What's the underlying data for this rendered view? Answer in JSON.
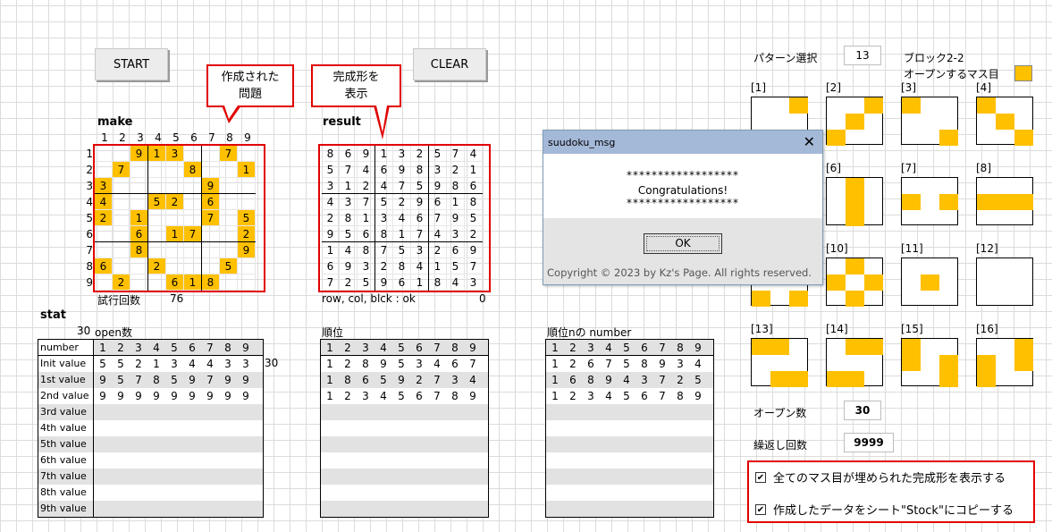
{
  "buttons": {
    "start": "START",
    "clear": "CLEAR"
  },
  "callouts": {
    "problem": [
      "作成された",
      "問題"
    ],
    "completed": [
      "完成形を",
      "表示"
    ]
  },
  "labels": {
    "make": "make",
    "result": "result",
    "trials_label": "試行回数",
    "trials_value": "76",
    "row_col_blck": "row, col, blck : ok",
    "ok_value": "0",
    "stat": "stat",
    "open_count_num": "30",
    "open_count_label": "open数",
    "rank": "順位",
    "rank_number": "順位nの number"
  },
  "colnums": [
    "1",
    "2",
    "3",
    "4",
    "5",
    "6",
    "7",
    "8",
    "9"
  ],
  "make_grid": [
    [
      "",
      "",
      "9",
      "1",
      "3",
      "",
      "",
      "7",
      ""
    ],
    [
      "",
      "7",
      "",
      "",
      "",
      "8",
      "",
      "",
      "1"
    ],
    [
      "3",
      "",
      "",
      "",
      "",
      "",
      "9",
      "",
      ""
    ],
    [
      "4",
      "",
      "",
      "5",
      "2",
      "",
      "6",
      "",
      ""
    ],
    [
      "2",
      "",
      "1",
      "",
      "",
      "",
      "7",
      "",
      "5"
    ],
    [
      "",
      "",
      "6",
      "",
      "1",
      "7",
      "",
      "",
      "2"
    ],
    [
      "",
      "",
      "8",
      "",
      "",
      "",
      "",
      "",
      "9"
    ],
    [
      "6",
      "",
      "",
      "2",
      "",
      "",
      "",
      "5",
      ""
    ],
    [
      "",
      "2",
      "",
      "",
      "6",
      "1",
      "8",
      "",
      ""
    ]
  ],
  "make_highlight": [
    [
      0,
      0,
      1,
      1,
      1,
      0,
      0,
      1,
      0
    ],
    [
      0,
      1,
      0,
      0,
      0,
      1,
      0,
      0,
      1
    ],
    [
      1,
      0,
      0,
      0,
      0,
      0,
      1,
      0,
      0
    ],
    [
      1,
      0,
      0,
      1,
      1,
      0,
      1,
      0,
      0
    ],
    [
      1,
      0,
      1,
      0,
      0,
      0,
      1,
      0,
      1
    ],
    [
      0,
      0,
      1,
      0,
      1,
      1,
      0,
      0,
      1
    ],
    [
      0,
      0,
      1,
      0,
      0,
      0,
      0,
      0,
      1
    ],
    [
      1,
      0,
      0,
      1,
      0,
      0,
      0,
      1,
      0
    ],
    [
      0,
      1,
      0,
      0,
      1,
      1,
      1,
      0,
      0
    ]
  ],
  "result_grid": [
    [
      "8",
      "6",
      "9",
      "1",
      "3",
      "2",
      "5",
      "7",
      "4"
    ],
    [
      "5",
      "7",
      "4",
      "6",
      "9",
      "8",
      "3",
      "2",
      "1"
    ],
    [
      "3",
      "1",
      "2",
      "4",
      "7",
      "5",
      "9",
      "8",
      "6"
    ],
    [
      "4",
      "3",
      "7",
      "5",
      "2",
      "9",
      "6",
      "1",
      "8"
    ],
    [
      "2",
      "8",
      "1",
      "3",
      "4",
      "6",
      "7",
      "9",
      "5"
    ],
    [
      "9",
      "5",
      "6",
      "8",
      "1",
      "7",
      "4",
      "3",
      "2"
    ],
    [
      "1",
      "4",
      "8",
      "7",
      "5",
      "3",
      "2",
      "6",
      "9"
    ],
    [
      "6",
      "9",
      "3",
      "2",
      "8",
      "4",
      "1",
      "5",
      "7"
    ],
    [
      "7",
      "2",
      "5",
      "9",
      "6",
      "1",
      "8",
      "4",
      "3"
    ]
  ],
  "stat_table": {
    "header": "number",
    "rows": [
      {
        "label": "Init value",
        "values": [
          "5",
          "5",
          "2",
          "1",
          "3",
          "4",
          "4",
          "3",
          "3"
        ],
        "extra": "30"
      },
      {
        "label": "1st value",
        "values": [
          "9",
          "5",
          "7",
          "8",
          "5",
          "9",
          "7",
          "9",
          "9"
        ]
      },
      {
        "label": "2nd value",
        "values": [
          "9",
          "9",
          "9",
          "9",
          "9",
          "9",
          "9",
          "9",
          "9"
        ]
      },
      {
        "label": "3rd value",
        "values": []
      },
      {
        "label": "4th value",
        "values": []
      },
      {
        "label": "5th value",
        "values": []
      },
      {
        "label": "6th value",
        "values": []
      },
      {
        "label": "7th value",
        "values": []
      },
      {
        "label": "8th value",
        "values": []
      },
      {
        "label": "9th value",
        "values": []
      }
    ]
  },
  "rank_table": [
    [
      "1",
      "2",
      "8",
      "9",
      "5",
      "3",
      "4",
      "6",
      "7"
    ],
    [
      "1",
      "8",
      "6",
      "5",
      "9",
      "2",
      "7",
      "3",
      "4"
    ],
    [
      "1",
      "2",
      "3",
      "4",
      "5",
      "6",
      "7",
      "8",
      "9"
    ]
  ],
  "rank_number_table": [
    [
      "1",
      "2",
      "6",
      "7",
      "5",
      "8",
      "9",
      "3",
      "4"
    ],
    [
      "1",
      "6",
      "8",
      "9",
      "4",
      "3",
      "7",
      "2",
      "5"
    ],
    [
      "1",
      "2",
      "3",
      "4",
      "5",
      "6",
      "7",
      "8",
      "9"
    ]
  ],
  "right": {
    "pattern_label": "パターン選択",
    "pattern_value": "13",
    "block_label": "ブロック2-2",
    "open_cell_label": "オープンするマス目",
    "open_count_label": "オープン数",
    "open_count_value": "30",
    "repeat_label": "繰返し回数",
    "repeat_value": "9999",
    "check1": "全てのマス目が埋められた完成形を表示する",
    "check2": "作成したデータをシート\"Stock\"にコピーする"
  },
  "patterns": [
    {
      "label": "[1]",
      "cells": [
        [
          2,
          0
        ]
      ]
    },
    {
      "label": "[2]",
      "cells": [
        [
          2,
          0
        ],
        [
          1,
          1
        ],
        [
          0,
          2
        ]
      ]
    },
    {
      "label": "[3]",
      "cells": [
        [
          0,
          0
        ],
        [
          2,
          2
        ]
      ]
    },
    {
      "label": "[4]",
      "cells": [
        [
          0,
          0
        ],
        [
          1,
          1
        ],
        [
          2,
          2
        ]
      ]
    },
    {
      "label": "[6]",
      "cells": [
        [
          1,
          0
        ],
        [
          1,
          1
        ],
        [
          1,
          2
        ]
      ]
    },
    {
      "label": "[7]",
      "cells": [
        [
          0,
          1
        ],
        [
          2,
          1
        ]
      ]
    },
    {
      "label": "[8]",
      "cells": [
        [
          0,
          1
        ],
        [
          1,
          1
        ],
        [
          2,
          1
        ]
      ]
    },
    {
      "label": "[10]",
      "cells": [
        [
          1,
          0
        ],
        [
          0,
          1
        ],
        [
          2,
          1
        ],
        [
          1,
          2
        ]
      ]
    },
    {
      "label": "[11]",
      "cells": [
        [
          1,
          1
        ]
      ]
    },
    {
      "label": "[12]",
      "cells": []
    },
    {
      "label": "[13]",
      "cells": [
        [
          0,
          0
        ],
        [
          1,
          0
        ],
        [
          1,
          2
        ],
        [
          2,
          2
        ]
      ]
    },
    {
      "label": "[14]",
      "cells": [
        [
          1,
          0
        ],
        [
          2,
          0
        ],
        [
          0,
          2
        ],
        [
          1,
          2
        ]
      ]
    },
    {
      "label": "[15]",
      "cells": [
        [
          0,
          0
        ],
        [
          0,
          1
        ],
        [
          2,
          1
        ],
        [
          2,
          2
        ]
      ]
    },
    {
      "label": "[16]",
      "cells": [
        [
          0,
          1
        ],
        [
          0,
          2
        ],
        [
          2,
          0
        ],
        [
          2,
          1
        ]
      ]
    }
  ],
  "dialog": {
    "title": "suudoku_msg",
    "stars1": "******************",
    "message": "Congratulations!",
    "stars2": "******************",
    "ok": "OK",
    "copyright": "Copyright © 2023 by Kz's Page. All rights reserved."
  },
  "colors": {
    "highlight": "#ffc000",
    "red": "#e00000"
  }
}
